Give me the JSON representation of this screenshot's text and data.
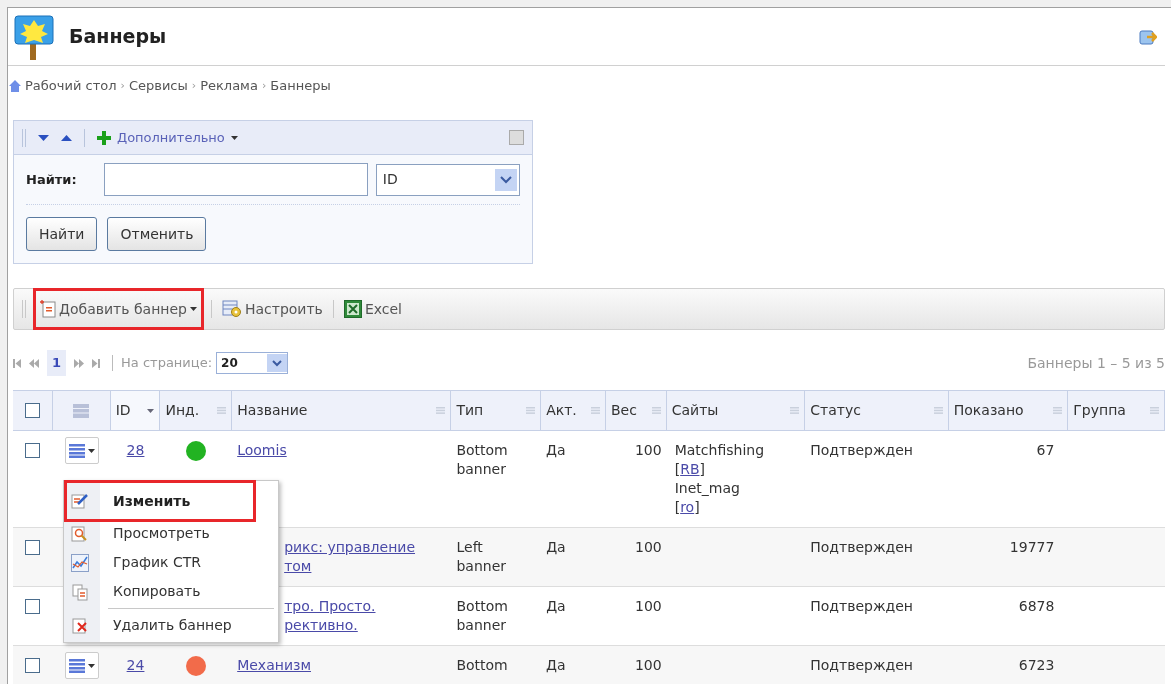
{
  "title": "Баннеры",
  "breadcrumb": [
    {
      "label": "Рабочий стол"
    },
    {
      "separator": "›",
      "label": "Сервисы"
    },
    {
      "separator": "›",
      "label": "Реклама"
    },
    {
      "separator": "›",
      "label": "Баннеры"
    }
  ],
  "filter": {
    "panel_checked": false,
    "more_label": "Дополнительно",
    "find_label": "Найти:",
    "field_select": "ID",
    "buttons": [
      "Найти",
      "Отменить"
    ]
  },
  "toolbar": [
    {
      "kind": "add",
      "label": "Добавить баннер",
      "highlighted": true
    },
    {
      "kind": "settings",
      "label": "Настроить",
      "highlighted": false
    },
    {
      "kind": "excel",
      "label": "Excel",
      "highlighted": false
    }
  ],
  "pager": {
    "current_page": "1",
    "per_page_label": "На странице:",
    "per_page": "20",
    "summary": "Баннеры 1 – 5 из 5"
  },
  "table": {
    "all_checked": false,
    "brackets": [
      "[",
      "]"
    ],
    "columns": [
      {
        "label": "ID",
        "sorted": true
      },
      {
        "label": "Инд.",
        "sorted": false
      },
      {
        "label": "Название",
        "sorted": false
      },
      {
        "label": "Тип",
        "sorted": false
      },
      {
        "label": "Акт.",
        "sorted": false
      },
      {
        "label": "Вес",
        "sorted": false
      },
      {
        "label": "Сайты",
        "sorted": false
      },
      {
        "label": "Статус",
        "sorted": false
      },
      {
        "label": "Показано",
        "sorted": false
      },
      {
        "label": "Группа",
        "sorted": false
      }
    ],
    "rows": [
      {
        "checked": false,
        "menu_button": true,
        "id": "28",
        "color": "#22b322",
        "name": "Loomis",
        "name_clipped": false,
        "type": "Bottom\nbanner",
        "active": "Да",
        "weight": "100",
        "sites": [
          {
            "name": "Matchfishing",
            "code": "RB"
          },
          {
            "name": "Inet_mag",
            "code": "ro"
          }
        ],
        "status": "Подтвержден",
        "shown": "67"
      },
      {
        "checked": false,
        "menu_button": false,
        "name": "рикс: управление\nтом",
        "name_clipped": true,
        "type": "Left\nbanner",
        "active": "Да",
        "weight": "100",
        "sites": [],
        "status": "Подтвержден",
        "shown": "19777"
      },
      {
        "checked": false,
        "menu_button": false,
        "name": "тро. Просто.\nрективно.",
        "name_clipped": true,
        "type": "Bottom\nbanner",
        "active": "Да",
        "weight": "100",
        "sites": [],
        "status": "Подтвержден",
        "shown": "6878"
      },
      {
        "checked": false,
        "menu_button": true,
        "id": "24",
        "color": "#f26b4a",
        "name": "Механизм",
        "name_clipped": false,
        "type": "Bottom",
        "active": "Да",
        "weight": "100",
        "sites": [],
        "status": "Подтвержден",
        "shown": "6723"
      }
    ]
  },
  "row_menu": [
    {
      "kind": "edit",
      "label": "Изменить",
      "highlighted": true
    },
    {
      "kind": "view",
      "label": "Просмотреть",
      "highlighted": false
    },
    {
      "kind": "chart",
      "label": "График CTR",
      "highlighted": false
    },
    {
      "kind": "copy",
      "label": "Копировать",
      "highlighted": false
    },
    {
      "kind": "delete",
      "label": "Удалить баннер",
      "highlighted": false,
      "separator_before": true
    }
  ]
}
